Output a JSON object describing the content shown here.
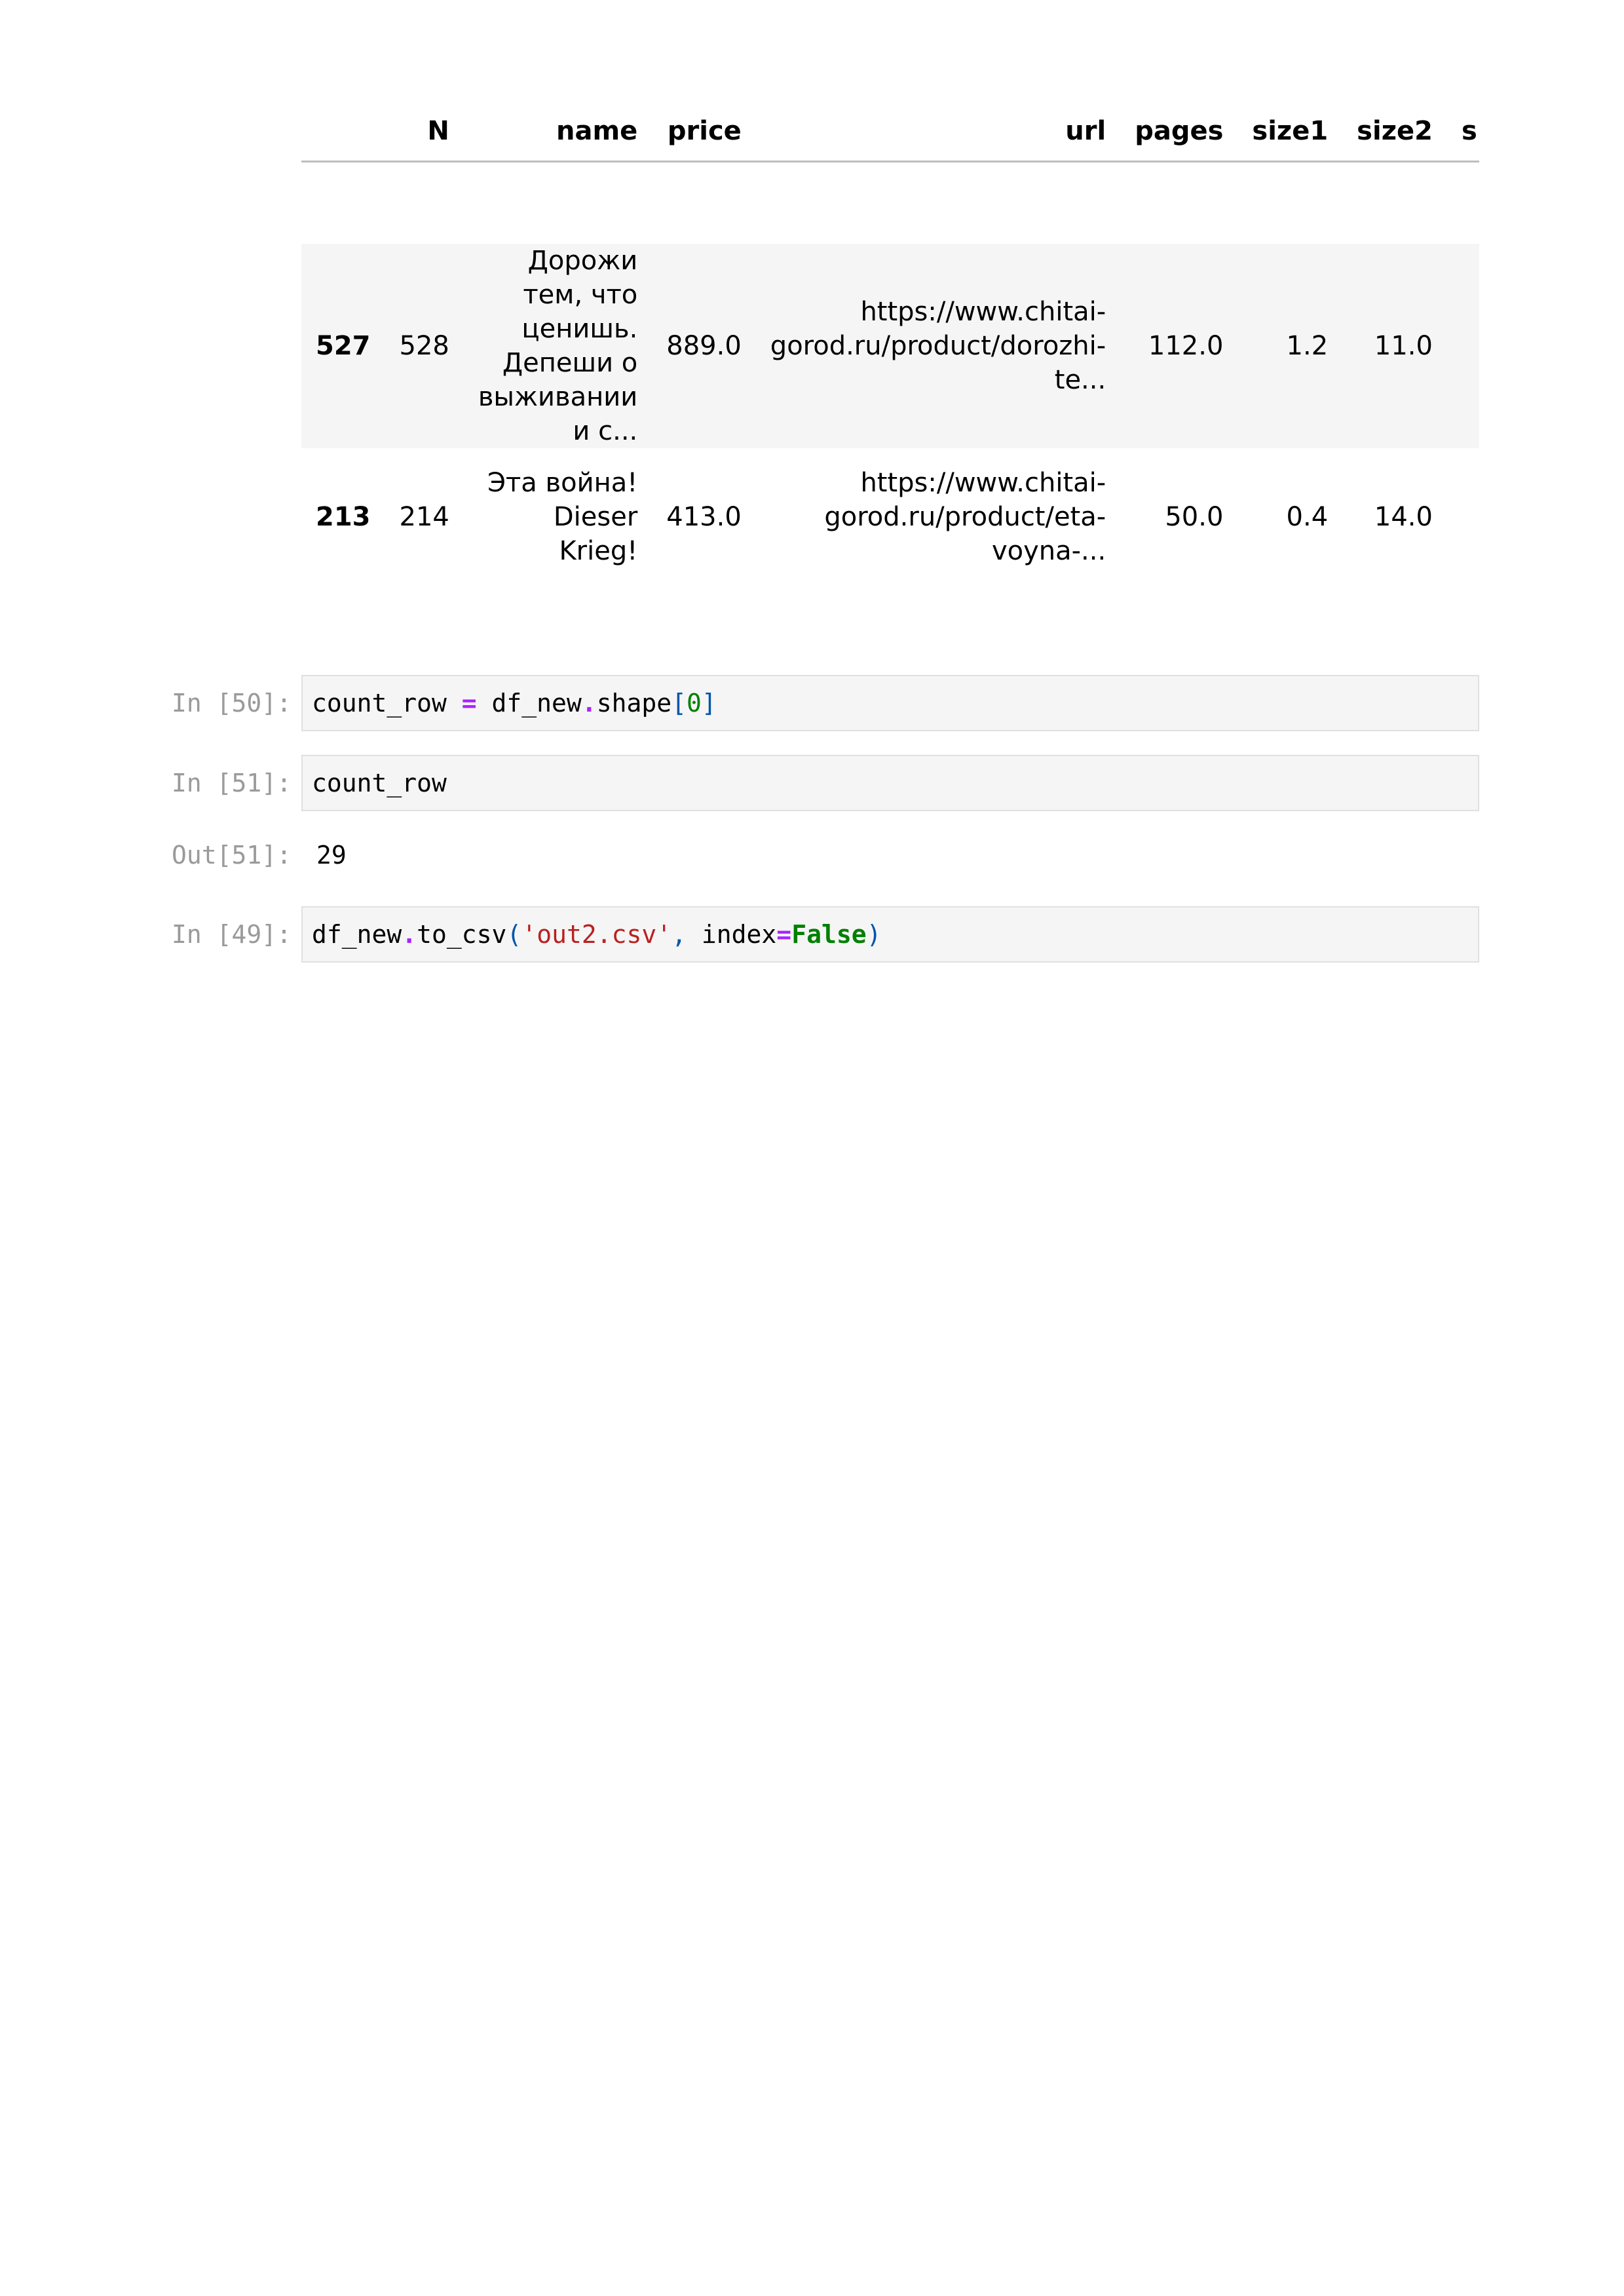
{
  "dataframe": {
    "columns": [
      "",
      "N",
      "name",
      "price",
      "url",
      "pages",
      "size1",
      "size2",
      "s"
    ],
    "rows": [
      {
        "index": "527",
        "N": "528",
        "name": "Дорожи тем, что ценишь. Депеши о выживании и с...",
        "price": "889.0",
        "url": "https://www.chitai-gorod.ru/product/dorozhi-te...",
        "pages": "112.0",
        "size1": "1.2",
        "size2": "11.0"
      },
      {
        "index": "213",
        "N": "214",
        "name": "Эта война! Dieser Krieg!",
        "price": "413.0",
        "url": "https://www.chitai-gorod.ru/product/eta-voyna-...",
        "pages": "50.0",
        "size1": "0.4",
        "size2": "14.0"
      }
    ]
  },
  "cells": [
    {
      "prompt": "In [50]:",
      "code_tokens": {
        "t1": "count_row ",
        "t2": "=",
        "t3": " df_new",
        "t4": ".",
        "t5": "shape",
        "t6": "[",
        "t7": "0",
        "t8": "]"
      }
    },
    {
      "prompt": "In [51]:",
      "code_tokens": {
        "t1": "count_row"
      },
      "out_prompt": "Out[51]:",
      "output": "29"
    },
    {
      "prompt": "In [49]:",
      "code_tokens": {
        "t1": "df_new",
        "t2": ".",
        "t3": "to_csv",
        "t4": "(",
        "t5": "'out2.csv'",
        "t6": ",",
        "t7": " index",
        "t8": "=",
        "t9": "False",
        "t10": ")"
      }
    }
  ],
  "colors": {
    "prompt": "#9a9a9a",
    "code_bg": "#f5f5f5",
    "operator": "#aa22ff",
    "number": "#008000",
    "string": "#ba2121",
    "keyword": "#008000"
  }
}
